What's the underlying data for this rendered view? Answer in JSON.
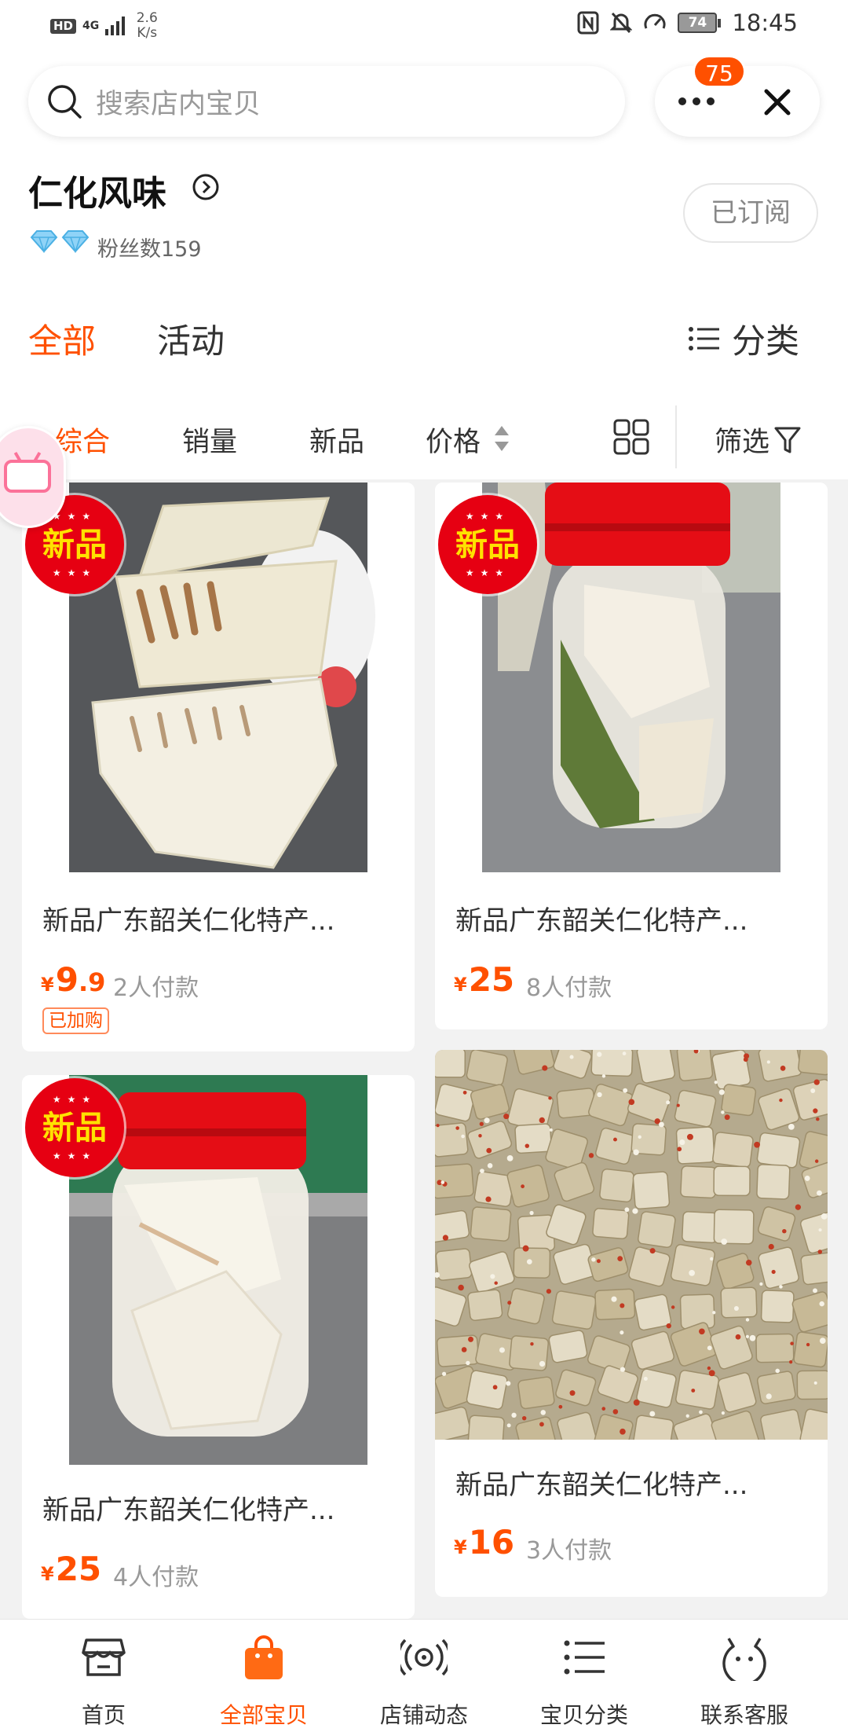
{
  "status_bar": {
    "network_hd": "HD",
    "network_type": "4G",
    "speed_value": "2.6",
    "speed_unit": "K/s",
    "battery": "74",
    "time": "18:45"
  },
  "header": {
    "search_placeholder": "搜索店内宝贝",
    "message_badge": "75",
    "more_icon": "more-dots-icon",
    "close_icon": "close-icon"
  },
  "shop": {
    "name": "仁化风味",
    "fans_label": "粉丝数159",
    "subscribe_label": "已订阅"
  },
  "tabs": {
    "all": "全部",
    "activity": "活动",
    "category": "分类"
  },
  "sort_bar": {
    "items": [
      "综合",
      "销量",
      "新品",
      "价格"
    ],
    "filter": "筛选"
  },
  "products": [
    {
      "badge": "新品",
      "title": "新品广东韶关仁化特产...",
      "price_symbol": "¥",
      "price_int": "9",
      "price_dec": ".9",
      "sold": "2人付款",
      "tag": "已加购"
    },
    {
      "badge": "新品",
      "title": "新品广东韶关仁化特产...",
      "price_symbol": "¥",
      "price_int": "25",
      "price_dec": "",
      "sold": "8人付款",
      "tag": ""
    },
    {
      "badge": "新品",
      "title": "新品广东韶关仁化特产...",
      "price_symbol": "¥",
      "price_int": "25",
      "price_dec": "",
      "sold": "4人付款",
      "tag": ""
    },
    {
      "badge": "",
      "title": "新品广东韶关仁化特产...",
      "price_symbol": "¥",
      "price_int": "16",
      "price_dec": "",
      "sold": "3人付款",
      "tag": ""
    }
  ],
  "bottom_nav": [
    {
      "label": "首页",
      "icon": "shop-icon"
    },
    {
      "label": "全部宝贝",
      "icon": "shopping-bag-icon"
    },
    {
      "label": "店铺动态",
      "icon": "broadcast-icon"
    },
    {
      "label": "宝贝分类",
      "icon": "list-icon"
    },
    {
      "label": "联系客服",
      "icon": "service-icon"
    }
  ],
  "colors": {
    "accent": "#ff5000",
    "badge_red": "#e60012",
    "background_gray": "#f2f2f2"
  }
}
